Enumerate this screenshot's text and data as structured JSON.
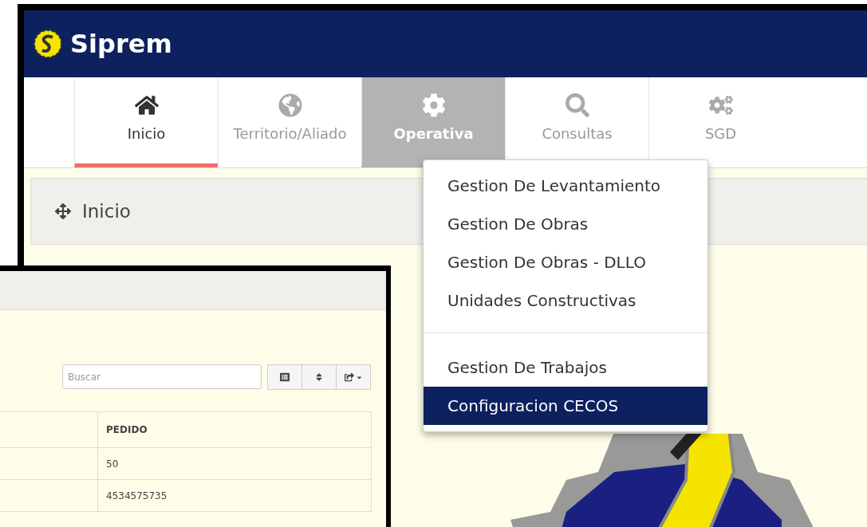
{
  "app": {
    "title": "Siprem"
  },
  "tabs": [
    {
      "label": "Inicio",
      "selected": true,
      "open": false
    },
    {
      "label": "Territorio/Aliado",
      "selected": false,
      "open": false
    },
    {
      "label": "Operativa",
      "selected": false,
      "open": true
    },
    {
      "label": "Consultas",
      "selected": false,
      "open": false
    },
    {
      "label": "SGD",
      "selected": false,
      "open": false
    }
  ],
  "breadcrumb": {
    "title": "Inicio"
  },
  "menu": {
    "groups": [
      {
        "items": [
          {
            "label": "Gestion De Levantamiento",
            "selected": false
          },
          {
            "label": "Gestion De Obras",
            "selected": false
          },
          {
            "label": "Gestion De Obras - DLLO",
            "selected": false
          },
          {
            "label": "Unidades Constructivas",
            "selected": false
          }
        ]
      },
      {
        "items": [
          {
            "label": "Gestion De Trabajos",
            "selected": false
          },
          {
            "label": "Configuracion CECOS",
            "selected": true
          }
        ]
      }
    ]
  },
  "table_window": {
    "search": {
      "placeholder": "Buscar"
    },
    "table": {
      "columns": [
        "PEDIDO"
      ],
      "rows": [
        [
          "50"
        ],
        [
          "4534575735"
        ]
      ]
    }
  }
}
